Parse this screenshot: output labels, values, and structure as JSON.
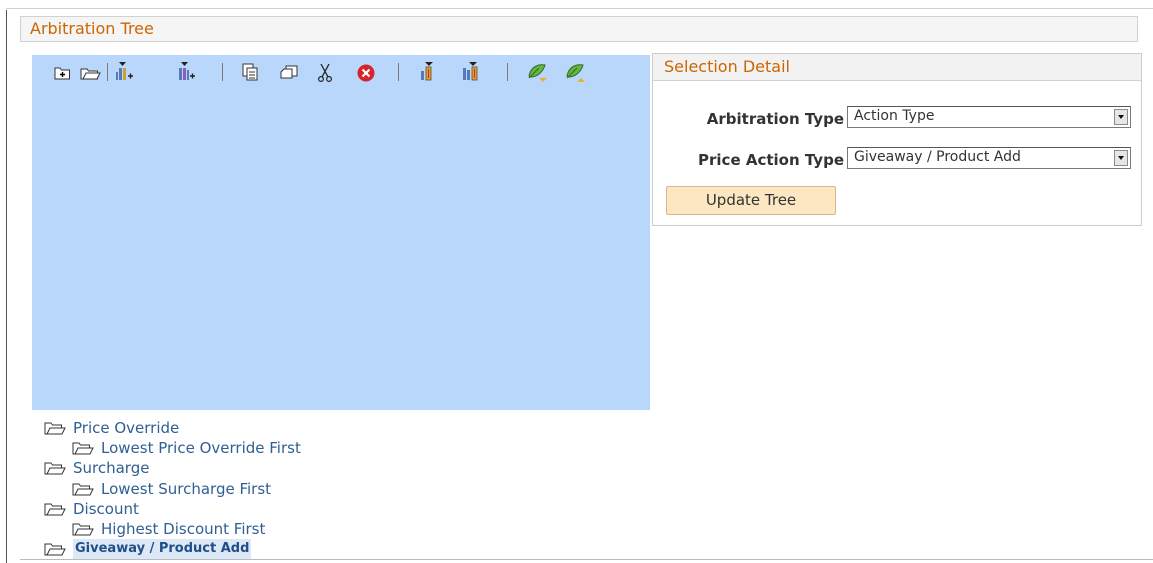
{
  "page": {
    "title": "Arbitration Tree"
  },
  "toolbar": {
    "items": [
      "insert-sibling-folder-icon",
      "insert-child-folder-icon",
      "insert-sibling-node-icon",
      "insert-child-node-icon",
      "copy-icon",
      "paste-icon",
      "cut-icon",
      "delete-icon",
      "move-up-icon",
      "move-down-icon",
      "expand-leaf-icon",
      "collapse-leaf-icon"
    ]
  },
  "selection_detail": {
    "title": "Selection Detail",
    "fields": [
      {
        "label": "Arbitration Type",
        "value": "Action Type"
      },
      {
        "label": "Price Action Type",
        "value": "Giveaway / Product Add"
      }
    ],
    "update_button": "Update Tree"
  },
  "tree": {
    "nodes": [
      {
        "label": "Price Override",
        "level": 0
      },
      {
        "label": "Lowest Price Override First",
        "level": 1
      },
      {
        "label": "Surcharge",
        "level": 0
      },
      {
        "label": "Lowest Surcharge First",
        "level": 1
      },
      {
        "label": "Discount",
        "level": 0
      },
      {
        "label": "Highest Discount First",
        "level": 1
      },
      {
        "label": "Giveaway / Product Add",
        "level": 0,
        "selected": true
      }
    ]
  },
  "colors": {
    "accent": "#cc6600",
    "link": "#2f5f93",
    "panel": "#b9d7fb",
    "button": "#fde7c3"
  }
}
